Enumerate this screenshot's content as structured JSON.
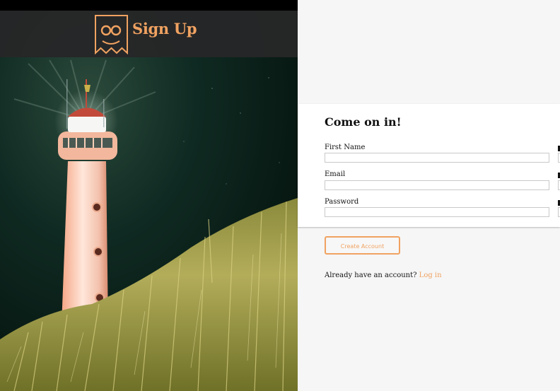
{
  "brand": {
    "title": "Sign Up"
  },
  "form": {
    "heading": "Come on in!",
    "fields": [
      {
        "label": "First Name",
        "value": ""
      },
      {
        "label": "Email",
        "value": ""
      },
      {
        "label": "Password",
        "value": ""
      }
    ],
    "submit_label": "Create Account",
    "login_prompt": "Already have an account?",
    "login_link": "Log in"
  },
  "colors": {
    "accent": "#f0a261",
    "brand_bar": "#262728",
    "page_bg": "#f6f6f6",
    "card_bg": "#ffffff"
  },
  "icons": [
    "logo-ticket-icon"
  ]
}
